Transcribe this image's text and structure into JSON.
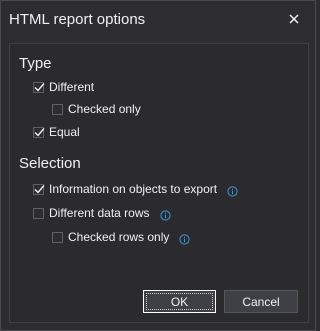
{
  "dialog": {
    "title": "HTML report options",
    "close_icon": "close-icon"
  },
  "type_section": {
    "title": "Type",
    "options": [
      {
        "label": "Different",
        "checked": true
      },
      {
        "label": "Checked only",
        "checked": false
      },
      {
        "label": "Equal",
        "checked": true
      }
    ]
  },
  "selection_section": {
    "title": "Selection",
    "options": [
      {
        "label": "Information on objects to export",
        "checked": true,
        "info_icon": "info-icon"
      },
      {
        "label": "Different data rows",
        "checked": false,
        "info_icon": "info-icon"
      },
      {
        "label": "Checked rows only",
        "checked": false,
        "info_icon": "info-icon"
      }
    ]
  },
  "buttons": {
    "ok": "OK",
    "cancel": "Cancel"
  },
  "colors": {
    "background": "#2d2d30",
    "text": "#f1f1f1",
    "info_accent": "#3a96dd"
  }
}
